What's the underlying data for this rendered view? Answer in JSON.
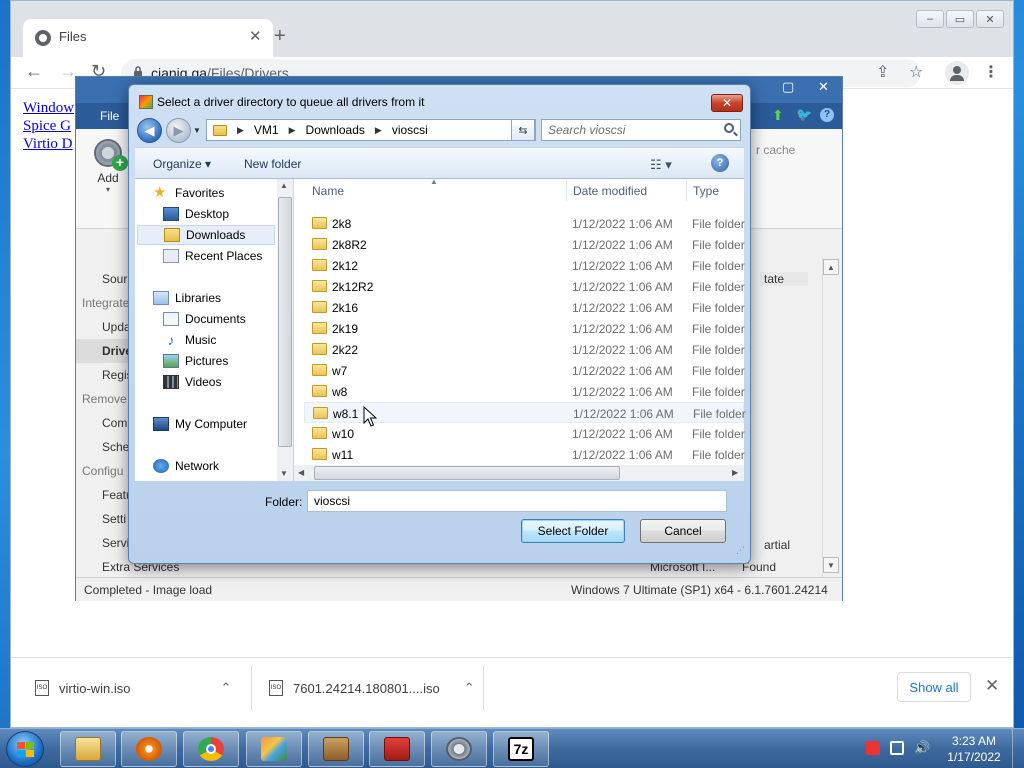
{
  "browser": {
    "tab_title": "Files",
    "tab_close": "✕",
    "new_tab": "+",
    "url_host": "cianig.ga",
    "url_path": "/Files/Drivers",
    "page_links": [
      "Window",
      "Spice G",
      "Virtio D"
    ],
    "window_controls": [
      "–",
      "▭",
      "✕"
    ]
  },
  "downloads": {
    "items": [
      {
        "name": "virtio-win.iso",
        "icon_label": "ISO"
      },
      {
        "name": "7601.24214.180801....iso",
        "icon_label": "ISO"
      }
    ],
    "show_all": "Show all",
    "close": "✕"
  },
  "app_window": {
    "file_tab": "File",
    "add_label": "Add",
    "cache_text": "r cache",
    "nav": [
      {
        "label": "Sour",
        "group": false
      },
      {
        "label": "Integrate",
        "group": true
      },
      {
        "label": "Upda",
        "group": false
      },
      {
        "label": "Drive",
        "group": false,
        "selected": true
      },
      {
        "label": "Regis",
        "group": false
      },
      {
        "label": "Remove",
        "group": true
      },
      {
        "label": "Com",
        "group": false
      },
      {
        "label": "Sche",
        "group": false
      },
      {
        "label": "Configu",
        "group": true
      },
      {
        "label": "Featu",
        "group": false
      },
      {
        "label": "Setti",
        "group": false
      },
      {
        "label": "Servi",
        "group": false
      },
      {
        "label": "Extra Services",
        "group": false
      }
    ],
    "state_col": "tate",
    "right_texts": [
      "artial",
      "Microsoft I...",
      "Found"
    ],
    "status_left": "Completed - Image load",
    "status_right": "Windows 7 Ultimate (SP1) x64 - 6.1.7601.24214"
  },
  "dialog": {
    "title": "Select a driver directory to queue all drivers from it",
    "close": "✕",
    "breadcrumb": [
      "VM1",
      "Downloads",
      "vioscsi"
    ],
    "search_placeholder": "Search vioscsi",
    "organize": "Organize ▾",
    "new_folder": "New folder",
    "help": "?",
    "nav": {
      "favorites": "Favorites",
      "fav_items": [
        "Desktop",
        "Downloads",
        "Recent Places"
      ],
      "libraries": "Libraries",
      "lib_items": [
        "Documents",
        "Music",
        "Pictures",
        "Videos"
      ],
      "computer": "My Computer",
      "network": "Network"
    },
    "columns": {
      "name": "Name",
      "date": "Date modified",
      "type": "Type"
    },
    "files": [
      {
        "name": "2k8",
        "date": "1/12/2022 1:06 AM",
        "type": "File folder"
      },
      {
        "name": "2k8R2",
        "date": "1/12/2022 1:06 AM",
        "type": "File folder"
      },
      {
        "name": "2k12",
        "date": "1/12/2022 1:06 AM",
        "type": "File folder"
      },
      {
        "name": "2k12R2",
        "date": "1/12/2022 1:06 AM",
        "type": "File folder"
      },
      {
        "name": "2k16",
        "date": "1/12/2022 1:06 AM",
        "type": "File folder"
      },
      {
        "name": "2k19",
        "date": "1/12/2022 1:06 AM",
        "type": "File folder"
      },
      {
        "name": "2k22",
        "date": "1/12/2022 1:06 AM",
        "type": "File folder"
      },
      {
        "name": "w7",
        "date": "1/12/2022 1:06 AM",
        "type": "File folder"
      },
      {
        "name": "w8",
        "date": "1/12/2022 1:06 AM",
        "type": "File folder"
      },
      {
        "name": "w8.1",
        "date": "1/12/2022 1:06 AM",
        "type": "File folder"
      },
      {
        "name": "w10",
        "date": "1/12/2022 1:06 AM",
        "type": "File folder"
      },
      {
        "name": "w11",
        "date": "1/12/2022 1:06 AM",
        "type": "File folder"
      }
    ],
    "folder_label": "Folder:",
    "folder_value": "vioscsi",
    "select_button": "Select Folder",
    "cancel_button": "Cancel"
  },
  "taskbar": {
    "time": "3:23 AM",
    "date": "1/17/2022",
    "apps": [
      "explorer",
      "media-player",
      "chrome",
      "ntlite",
      "archive-manager",
      "toolbox",
      "settings-gear",
      "7zip"
    ],
    "sevenzip_label": "7z"
  }
}
